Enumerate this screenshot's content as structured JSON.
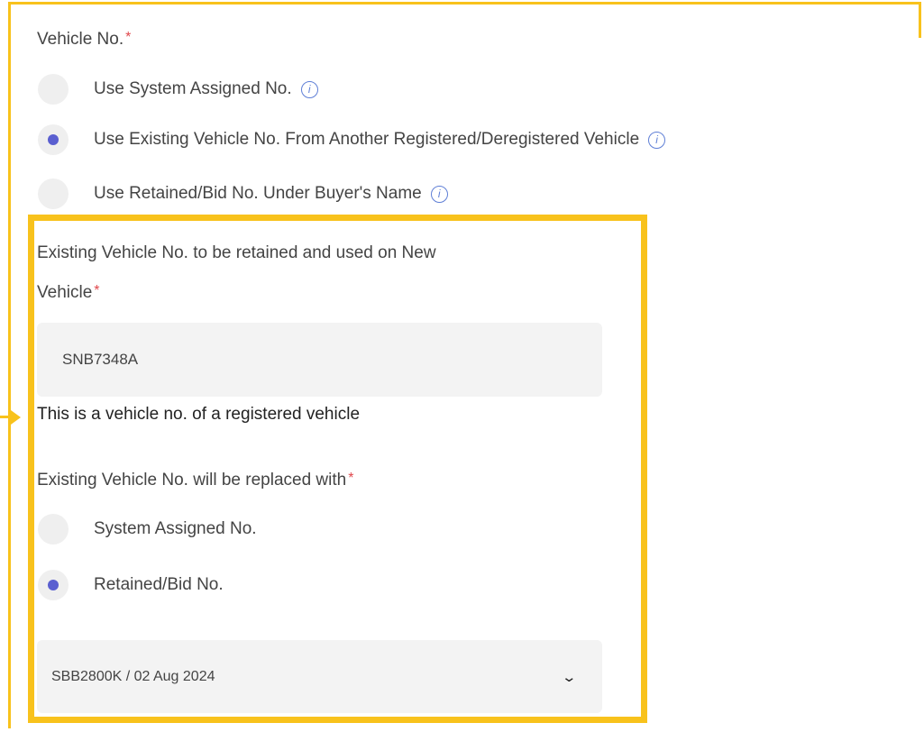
{
  "vehicle_no": {
    "label": "Vehicle No.",
    "required_mark": "*",
    "options": [
      {
        "label": "Use System Assigned No.",
        "checked": false
      },
      {
        "label": "Use Existing Vehicle No. From Another Registered/Deregistered Vehicle",
        "checked": true
      },
      {
        "label": "Use Retained/Bid No. Under Buyer's Name",
        "checked": false
      }
    ]
  },
  "existing_vehicle": {
    "label_line1": "Existing Vehicle No. to be retained and used on New",
    "label_line2": "Vehicle",
    "required_mark": "*",
    "value": "SNB7348A",
    "hint": "This is a vehicle no. of a registered vehicle"
  },
  "replacement": {
    "label": "Existing Vehicle No. will be replaced with",
    "required_mark": "*",
    "options": [
      {
        "label": "System Assigned No.",
        "checked": false
      },
      {
        "label": "Retained/Bid No.",
        "checked": true
      }
    ],
    "selected_value": "SBB2800K / 02 Aug 2024"
  },
  "icons": {
    "info": "info-icon",
    "dropdown": "chevron-down-icon",
    "info_glyph": "i",
    "chevron_glyph": "⌄"
  },
  "colors": {
    "highlight": "#f8c21c",
    "radio_checked": "#5a5fd0",
    "required": "#e0474c",
    "info": "#5f7fd6"
  }
}
